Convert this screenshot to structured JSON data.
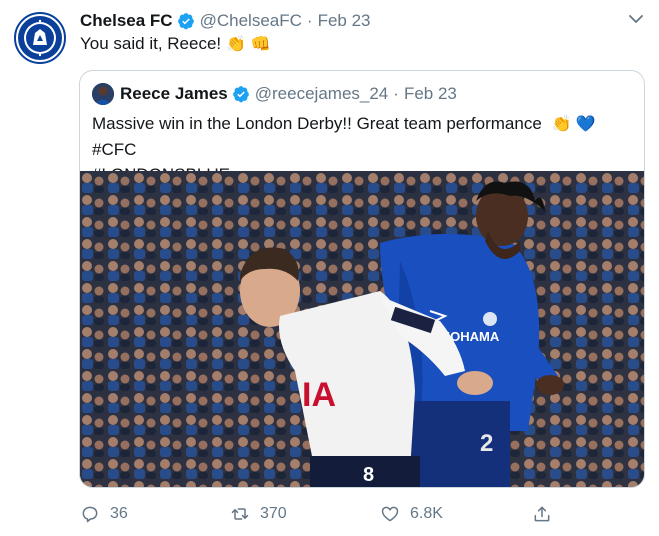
{
  "tweet": {
    "author_name": "Chelsea FC",
    "author_handle": "@ChelseaFC",
    "separator": "·",
    "date": "Feb 23",
    "text": "You said it, Reece!",
    "emoji": "👏 👊",
    "avatar_icon": "chelsea-crest-icon",
    "verified_icon": "verified-badge-icon"
  },
  "quoted_tweet": {
    "author_name": "Reece James",
    "author_handle": "@reecejames_24",
    "separator": "·",
    "date": "Feb 23",
    "text": "Massive win in the London Derby!! Great team performance",
    "emoji": "👏 💙",
    "hashtag_1": "#CFC",
    "hashtag_2": "#LONDONSBLUE",
    "photo_icon": "football-match-photo",
    "jersey_text_white": "IA",
    "jersey_number_white": "8",
    "jersey_text_blue": "YOKOHAMA",
    "jersey_number_blue": "2"
  },
  "actions": {
    "replies": "36",
    "retweets": "370",
    "likes": "6.8K",
    "reply_icon": "reply-icon",
    "retweet_icon": "retweet-icon",
    "like_icon": "heart-icon",
    "share_icon": "share-icon"
  },
  "colors": {
    "brand_blue": "#1da1f2",
    "chelsea_blue": "#0a3f9a",
    "text_secondary": "#657786",
    "border": "#ccd6dd"
  }
}
